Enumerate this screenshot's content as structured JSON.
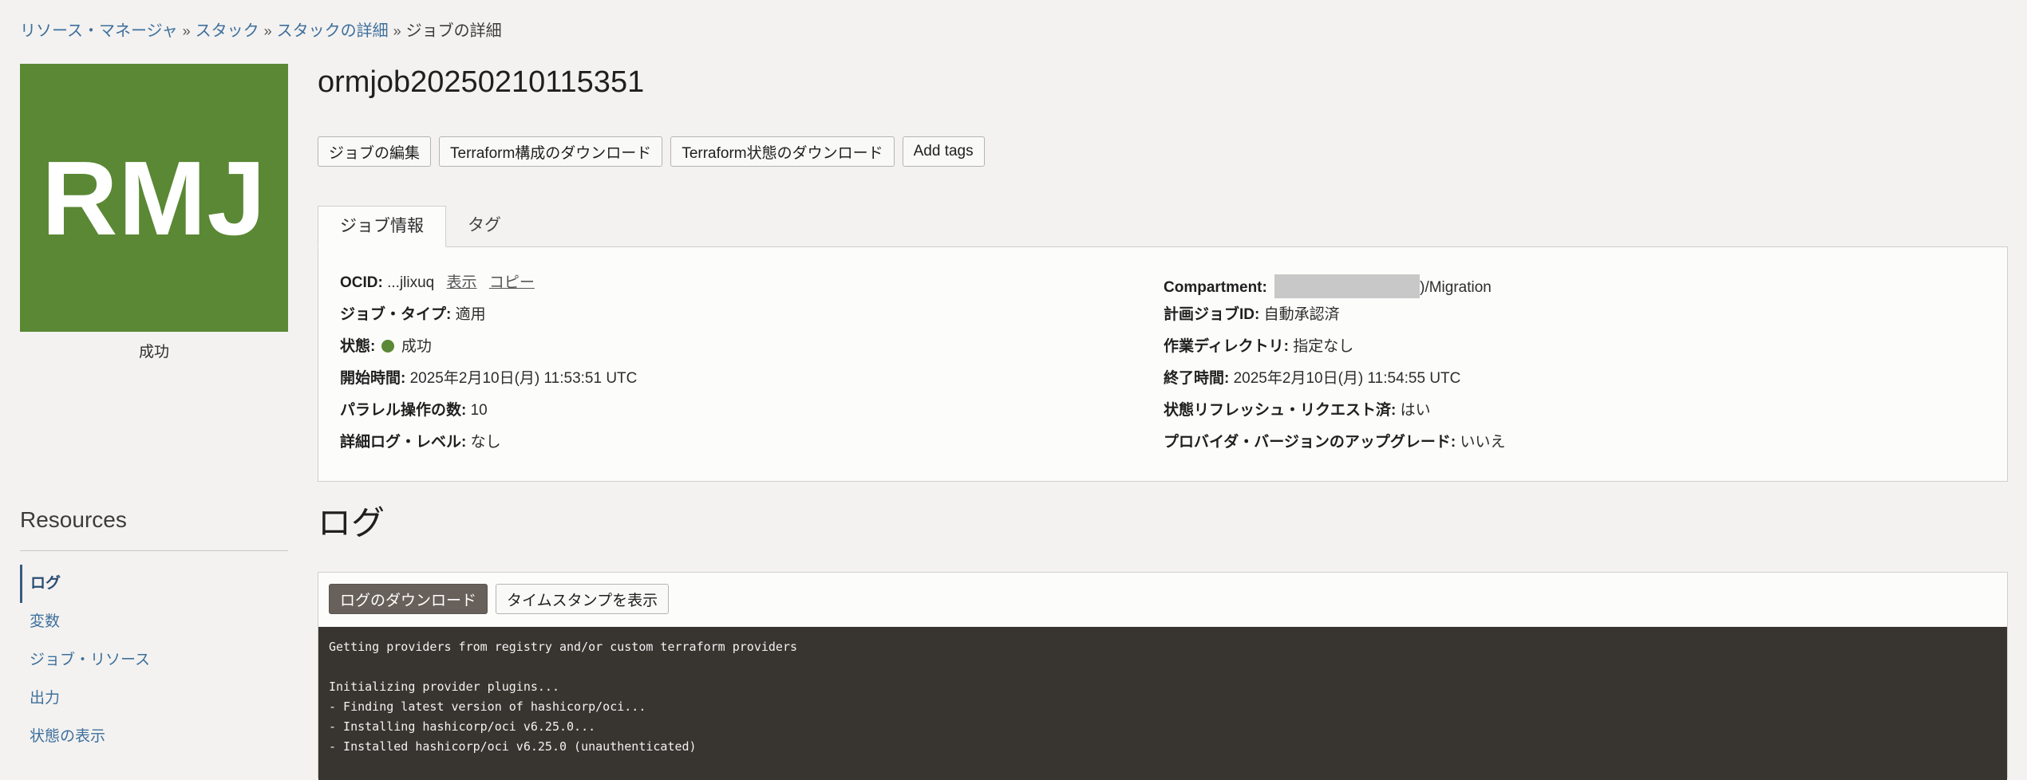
{
  "breadcrumb": {
    "items": [
      "リソース・マネージャ",
      "スタック",
      "スタックの詳細"
    ],
    "current": "ジョブの詳細",
    "separator": "»"
  },
  "logo": {
    "text": "RMJ",
    "color": "#5a8834",
    "status": "成功"
  },
  "page": {
    "title": "ormjob20250210115351"
  },
  "actions": {
    "edit_job": "ジョブの編集",
    "download_config": "Terraform構成のダウンロード",
    "download_state": "Terraform状態のダウンロード",
    "add_tags": "Add tags"
  },
  "tabs": [
    "ジョブ情報",
    "タグ"
  ],
  "job_info": {
    "ocid": {
      "label": "OCID:",
      "value": "...jlixuq",
      "show": "表示",
      "copy": "コピー"
    },
    "job_type": {
      "label": "ジョブ・タイプ:",
      "value": "適用"
    },
    "state": {
      "label": "状態:",
      "value": "成功",
      "color": "#5a8834"
    },
    "start_time": {
      "label": "開始時間:",
      "value": "2025年2月10日(月) 11:53:51 UTC"
    },
    "parallelism": {
      "label": "パラレル操作の数:",
      "value": "10"
    },
    "log_level": {
      "label": "詳細ログ・レベル:",
      "value": "なし"
    },
    "compartment": {
      "label": "Compartment:",
      "value": ")/Migration"
    },
    "plan_job_id": {
      "label": "計画ジョブID:",
      "value": "自動承認済"
    },
    "working_dir": {
      "label": "作業ディレクトリ:",
      "value": "指定なし"
    },
    "end_time": {
      "label": "終了時間:",
      "value": "2025年2月10日(月) 11:54:55 UTC"
    },
    "refresh_requested": {
      "label": "状態リフレッシュ・リクエスト済:",
      "value": "はい"
    },
    "provider_upgrade": {
      "label": "プロバイダ・バージョンのアップグレード:",
      "value": "いいえ"
    }
  },
  "logs": {
    "title": "ログ",
    "download": "ログのダウンロード",
    "show_timestamps": "タイムスタンプを表示",
    "lines": [
      "Getting providers from registry and/or custom terraform providers",
      "",
      "Initializing provider plugins...",
      "- Finding latest version of hashicorp/oci...",
      "- Installing hashicorp/oci v6.25.0...",
      "- Installed hashicorp/oci v6.25.0 (unauthenticated)"
    ]
  },
  "resources": {
    "title": "Resources",
    "items": [
      "ログ",
      "変数",
      "ジョブ・リソース",
      "出力",
      "状態の表示"
    ],
    "active": "ログ"
  }
}
